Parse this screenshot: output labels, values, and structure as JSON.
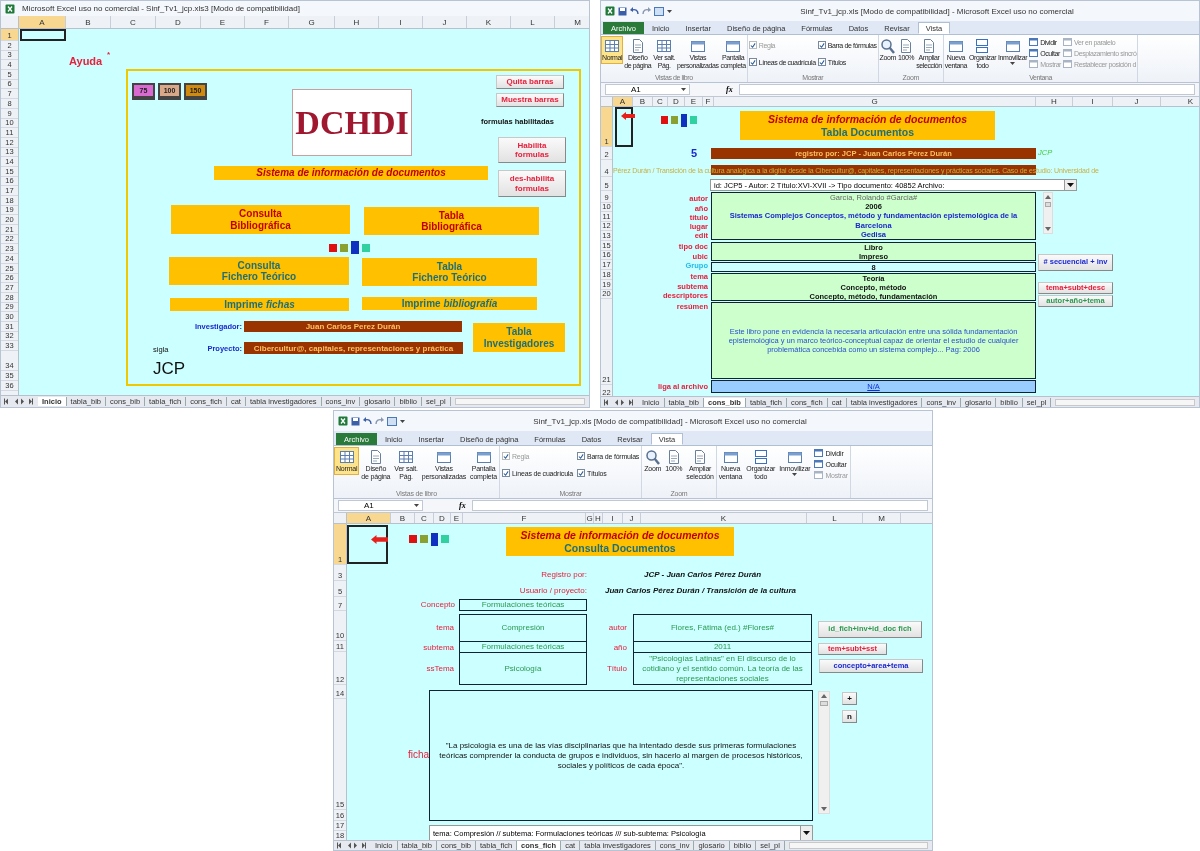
{
  "windows": [
    {
      "title": "Microsoft Excel uso no comercial - Sinf_Tv1_jcp.xls3 [Modo de compatibilidad]",
      "columns": [
        {
          "label": "A",
          "selected": true
        },
        {
          "label": "B",
          "selected": false
        },
        {
          "label": "C",
          "selected": false
        },
        {
          "label": "D",
          "selected": false
        },
        {
          "label": "E",
          "selected": false
        },
        {
          "label": "F",
          "selected": false
        },
        {
          "label": "G",
          "selected": false
        },
        {
          "label": "H",
          "selected": false
        },
        {
          "label": "I",
          "selected": false
        },
        {
          "label": "J",
          "selected": false
        },
        {
          "label": "K",
          "selected": false
        },
        {
          "label": "L",
          "selected": false
        },
        {
          "label": "M",
          "selected": false
        }
      ],
      "rows": [
        {
          "label": "1",
          "selected": true
        },
        {
          "label": "2",
          "selected": false
        },
        {
          "label": "3",
          "selected": false
        },
        {
          "label": "4",
          "selected": false
        },
        {
          "label": "5",
          "selected": false
        },
        {
          "label": "6",
          "selected": false
        },
        {
          "label": "7",
          "selected": false
        },
        {
          "label": "8",
          "selected": false
        },
        {
          "label": "9",
          "selected": false
        },
        {
          "label": "10",
          "selected": false
        },
        {
          "label": "11",
          "selected": false
        },
        {
          "label": "12",
          "selected": false
        },
        {
          "label": "13",
          "selected": false
        },
        {
          "label": "14",
          "selected": false
        },
        {
          "label": "15",
          "selected": false
        },
        {
          "label": "16",
          "selected": false
        },
        {
          "label": "17",
          "selected": false
        },
        {
          "label": "18",
          "selected": false
        },
        {
          "label": "19",
          "selected": false
        },
        {
          "label": "20",
          "selected": false
        },
        {
          "label": "21",
          "selected": false
        },
        {
          "label": "22",
          "selected": false
        },
        {
          "label": "23",
          "selected": false
        },
        {
          "label": "24",
          "selected": false
        },
        {
          "label": "25",
          "selected": false
        },
        {
          "label": "26",
          "selected": false
        },
        {
          "label": "27",
          "selected": false
        },
        {
          "label": "28",
          "selected": false
        },
        {
          "label": "29",
          "selected": false
        },
        {
          "label": "30",
          "selected": false
        },
        {
          "label": "31",
          "selected": false
        },
        {
          "label": "32",
          "selected": false
        },
        {
          "label": "33",
          "selected": false
        },
        {
          "label": "34",
          "selected": false
        },
        {
          "label": "35",
          "selected": false
        },
        {
          "label": "36",
          "selected": false
        }
      ],
      "shapes": [
        {
          "kind": "selected_cell"
        },
        {
          "kind": "label",
          "text": "Ayuda",
          "bold": true
        },
        {
          "kind": "label",
          "text": "*",
          "bold": true
        },
        {
          "kind": "frame"
        },
        {
          "kind": "monitors",
          "items": [
            {
              "text": "75",
              "color": "#d86ad0"
            },
            {
              "text": "100",
              "color": "#d8a888"
            },
            {
              "text": "150",
              "color": "#d08a10"
            }
          ]
        },
        {
          "kind": "logo",
          "text": "DCHDI"
        },
        {
          "kind": "button",
          "text": "Quita barras"
        },
        {
          "kind": "button",
          "text": "Muestra barras"
        },
        {
          "kind": "label",
          "text": "formulas habilitadas",
          "bold": true
        },
        {
          "kind": "button",
          "text": "Habilita formulas"
        },
        {
          "kind": "button",
          "text": "des-habilita formulas"
        },
        {
          "kind": "banner",
          "text": "Sistema de información de documentos",
          "italic": true
        },
        {
          "kind": "bar",
          "text": "Consulta\nBibliográfica"
        },
        {
          "kind": "bar",
          "text": "Tabla\nBibliográfica"
        },
        {
          "kind": "squares",
          "items": [
            {
              "color": "#e01010"
            },
            {
              "color": "#8aa030"
            },
            {
              "color": "#1030c0"
            },
            {
              "color": "#30d0a0"
            }
          ]
        },
        {
          "kind": "bar",
          "text": "Consulta\nFichero Teórico"
        },
        {
          "kind": "bar",
          "text": "Tabla\nFichero Teórico"
        },
        {
          "kind": "bar",
          "text": "Imprime *fichas*"
        },
        {
          "kind": "bar",
          "text": "Imprime *bibliografía*"
        },
        {
          "kind": "label",
          "text": "Investigador:",
          "bold": true
        },
        {
          "kind": "field",
          "text": "Juan Carlos Perez Durán"
        },
        {
          "kind": "label",
          "text": "Proyecto:",
          "bold": true
        },
        {
          "kind": "field",
          "text": "Cibercultur@, capitales, representaciones y práctica"
        },
        {
          "kind": "bar",
          "text": "Tabla\nInvestigadores"
        },
        {
          "kind": "label",
          "text": "sigla",
          "bold": false
        },
        {
          "kind": "label",
          "text": "JCP",
          "bold": false
        }
      ],
      "sheet_tabs": [
        {
          "label": "Inicio",
          "selected": true
        },
        {
          "label": "tabla_bib",
          "selected": false
        },
        {
          "label": "cons_bib",
          "selected": false
        },
        {
          "label": "tabla_fich",
          "selected": false
        },
        {
          "label": "cons_fich",
          "selected": false
        },
        {
          "label": "cat",
          "selected": false
        },
        {
          "label": "tabla investigadores",
          "selected": false
        },
        {
          "label": "cons_inv",
          "selected": false
        },
        {
          "label": "glosario",
          "selected": false
        },
        {
          "label": "biblio",
          "selected": false
        },
        {
          "label": "sel_pl",
          "selected": false
        }
      ]
    },
    {
      "title": "Sinf_Tv1_jcp.xls [Modo de compatibilidad] - Microsoft Excel uso no comercial",
      "ribbon": {
        "tabs": [
          {
            "label": "Archivo",
            "kind": "file",
            "selected": false
          },
          {
            "label": "Inicio",
            "kind": "tab",
            "selected": false
          },
          {
            "label": "Insertar",
            "kind": "tab",
            "selected": false
          },
          {
            "label": "Diseño de página",
            "kind": "tab",
            "selected": false
          },
          {
            "label": "Fórmulas",
            "kind": "tab",
            "selected": false
          },
          {
            "label": "Datos",
            "kind": "tab",
            "selected": false
          },
          {
            "label": "Revisar",
            "kind": "tab",
            "selected": false
          },
          {
            "label": "Vista",
            "kind": "tab",
            "selected": true
          }
        ],
        "groups": [
          {
            "label": "Vistas de libro",
            "items": [
              {
                "kind": "large",
                "label": "Normal",
                "selected": true
              },
              {
                "kind": "large",
                "label": "Diseño\nde página",
                "selected": false
              },
              {
                "kind": "large",
                "label": "Ver salt.\nPág.",
                "selected": false
              },
              {
                "kind": "large",
                "label": "Vistas\npersonalizadas",
                "selected": false
              },
              {
                "kind": "large",
                "label": "Pantalla\ncompleta",
                "selected": false
              }
            ]
          },
          {
            "label": "Mostrar",
            "items": [
              {
                "kind": "check",
                "label": "Regla",
                "checked": true,
                "disabled": true
              },
              {
                "kind": "check",
                "label": "Líneas de cuadrícula",
                "checked": true,
                "disabled": false
              },
              {
                "kind": "check",
                "label": "Barra de fórmulas",
                "checked": true,
                "disabled": false
              },
              {
                "kind": "check",
                "label": "Títulos",
                "checked": true,
                "disabled": false
              }
            ]
          },
          {
            "label": "Zoom",
            "items": [
              {
                "kind": "large",
                "label": "Zoom",
                "selected": false
              },
              {
                "kind": "large",
                "label": "100%",
                "selected": false
              },
              {
                "kind": "large",
                "label": "Ampliar\nselección",
                "selected": false
              }
            ]
          },
          {
            "label": "Ventana",
            "items": [
              {
                "kind": "large",
                "label": "Nueva\nventana",
                "selected": false
              },
              {
                "kind": "large",
                "label": "Organizar\ntodo",
                "selected": false
              },
              {
                "kind": "large",
                "label": "Inmovilizar",
                "selected": false,
                "menu": true
              },
              {
                "kind": "small",
                "label": "Dividir",
                "disabled": false
              },
              {
                "kind": "small",
                "label": "Ocultar",
                "disabled": false
              },
              {
                "kind": "small",
                "label": "Mostrar",
                "disabled": true
              },
              {
                "kind": "small",
                "label": "Ver en paralelo",
                "disabled": true
              },
              {
                "kind": "small",
                "label": "Desplazamiento sincró",
                "disabled": true
              },
              {
                "kind": "small",
                "label": "Restablecer posición d",
                "disabled": true
              }
            ]
          }
        ]
      },
      "formula_bar": {
        "name_box": "A1",
        "function_label": "fx"
      },
      "columns": [
        {
          "label": "A",
          "selected": true
        },
        {
          "label": "B",
          "selected": false
        },
        {
          "label": "C",
          "selected": false
        },
        {
          "label": "D",
          "selected": false
        },
        {
          "label": "E",
          "selected": false
        },
        {
          "label": "F",
          "selected": false
        },
        {
          "label": "G",
          "selected": false
        },
        {
          "label": "H",
          "selected": false
        },
        {
          "label": "I",
          "selected": false
        },
        {
          "label": "J",
          "selected": false
        },
        {
          "label": "K",
          "selected": false
        }
      ],
      "rows": [
        {
          "label": "1",
          "selected": true
        },
        {
          "label": "2",
          "selected": false
        },
        {
          "label": "4",
          "selected": false
        },
        {
          "label": "5",
          "selected": false
        },
        {
          "label": "9",
          "selected": false
        },
        {
          "label": "10",
          "selected": false
        },
        {
          "label": "11",
          "selected": false
        },
        {
          "label": "12",
          "selected": false
        },
        {
          "label": "13",
          "selected": false
        },
        {
          "label": "15",
          "selected": false
        },
        {
          "label": "16",
          "selected": false
        },
        {
          "label": "17",
          "selected": false
        },
        {
          "label": "18",
          "selected": false
        },
        {
          "label": "19",
          "selected": false
        },
        {
          "label": "20",
          "selected": false
        },
        {
          "label": "21",
          "selected": false
        },
        {
          "label": "22",
          "selected": false
        }
      ],
      "shapes": [
        {
          "kind": "selected_cell"
        },
        {
          "kind": "arrow"
        },
        {
          "kind": "squares",
          "items": [
            {
              "color": "#e01010"
            },
            {
              "color": "#8aa030"
            },
            {
              "color": "#1030c0"
            },
            {
              "color": "#30d0a0"
            }
          ]
        },
        {
          "kind": "title_box",
          "lines": [
            {
              "text": "Sistema de información de documentos",
              "italic": true
            },
            {
              "text": "Tabla Documentos",
              "italic": false
            }
          ]
        },
        {
          "kind": "label",
          "text": "5",
          "bold": true
        },
        {
          "kind": "field",
          "text": "registro por: JCP - Juan Carlos Pérez Durán"
        },
        {
          "kind": "label",
          "text": "JCP",
          "bold": false,
          "italic": true
        },
        {
          "kind": "banded_label",
          "text": "Pérez Durán / Transición de la cultura analógica a la digital desde la Cibercultur@, capitales, representaciones y prácticas sociales. Caso de estudio: Universidad de"
        },
        {
          "kind": "combo",
          "text": "id: JCP5 - Autor: 2 Título:XVI-XVII -> Tipo documento: 40852 Archivo:"
        },
        {
          "kind": "labels",
          "bold": true,
          "items": [
            {
              "text": "autor"
            },
            {
              "text": "año"
            },
            {
              "text": "título"
            },
            {
              "text": "lugar"
            },
            {
              "text": "edit"
            },
            {
              "text": "tipo doc"
            },
            {
              "text": "ubic"
            },
            {
              "text": "Grupo"
            },
            {
              "text": "tema"
            },
            {
              "text": "subtema"
            },
            {
              "text": "descriptores"
            },
            {
              "text": "resúmen"
            }
          ]
        },
        {
          "kind": "box",
          "color": "#ccffcc",
          "sections": [
            {
              "lines": [
                {
                  "text": "García, Rolando #Garcia#",
                  "bold": false
                },
                {
                  "text": "2006",
                  "bold": true
                },
                {
                  "text": "Sistemas Complejos Conceptos, método y fundamentación epistemológica de la",
                  "bold": true
                },
                {
                  "text": "Barcelona",
                  "bold": true
                },
                {
                  "text": "Gedisa",
                  "bold": true
                }
              ]
            }
          ]
        },
        {
          "kind": "scrollbar"
        },
        {
          "kind": "box",
          "color": "#ccffcc",
          "sections": [
            {
              "lines": [
                {
                  "text": "Libro",
                  "bold": true
                },
                {
                  "text": "Impreso",
                  "bold": true
                }
              ]
            }
          ]
        },
        {
          "kind": "box",
          "color": "#ccffff",
          "sections": [
            {
              "lines": [
                {
                  "text": "8",
                  "bold": true
                }
              ]
            }
          ]
        },
        {
          "kind": "box",
          "color": "#ccffcc",
          "sections": [
            {
              "lines": [
                {
                  "text": "Teoría",
                  "bold": true
                },
                {
                  "text": "Concepto, método",
                  "bold": true
                },
                {
                  "text": "Concepto, método, fundamentación",
                  "bold": true
                }
              ]
            }
          ]
        },
        {
          "kind": "box",
          "color": "#ccffcc",
          "sections": [
            {
              "lines": [
                {
                  "text": "Este libro pone en evidencia la necesaria articulación entre una sólida fundamentación epistemológica y un marco teórico-conceptual capaz de orientar el estudio de cualquier problemática concebida como un sistema complejo... Pag: 2006",
                  "bold": false
                }
              ]
            }
          ]
        },
        {
          "kind": "box",
          "color": "#99ccff",
          "sections": [
            {
              "lines": [
                {
                  "text": "N/A",
                  "kind": "link",
                  "bold": false
                }
              ]
            }
          ]
        },
        {
          "kind": "button",
          "text": "# secuencial + inv"
        },
        {
          "kind": "button",
          "text": "tema+subt+desc"
        },
        {
          "kind": "button",
          "text": "autor+año+tema"
        },
        {
          "kind": "label",
          "text": "liga al archivo",
          "bold": true
        }
      ],
      "sheet_tabs": [
        {
          "label": "Inicio",
          "selected": false
        },
        {
          "label": "tabla_bib",
          "selected": false
        },
        {
          "label": "cons_bib",
          "selected": true
        },
        {
          "label": "tabla_fich",
          "selected": false
        },
        {
          "label": "cons_fich",
          "selected": false
        },
        {
          "label": "cat",
          "selected": false
        },
        {
          "label": "tabla investigadores",
          "selected": false
        },
        {
          "label": "cons_inv",
          "selected": false
        },
        {
          "label": "glosario",
          "selected": false
        },
        {
          "label": "biblio",
          "selected": false
        },
        {
          "label": "sel_pl",
          "selected": false
        }
      ]
    },
    {
      "title": "Sinf_Tv1_jcp.xls [Modo de compatibilidad] - Microsoft Excel uso no comercial",
      "ribbon": {
        "tabs": [
          {
            "label": "Archivo",
            "kind": "file",
            "selected": false
          },
          {
            "label": "Inicio",
            "kind": "tab",
            "selected": false
          },
          {
            "label": "Insertar",
            "kind": "tab",
            "selected": false
          },
          {
            "label": "Diseño de página",
            "kind": "tab",
            "selected": false
          },
          {
            "label": "Fórmulas",
            "kind": "tab",
            "selected": false
          },
          {
            "label": "Datos",
            "kind": "tab",
            "selected": false
          },
          {
            "label": "Revisar",
            "kind": "tab",
            "selected": false
          },
          {
            "label": "Vista",
            "kind": "tab",
            "selected": true
          }
        ],
        "groups": [
          {
            "label": "Vistas de libro",
            "items": [
              {
                "kind": "large",
                "label": "Normal",
                "selected": true
              },
              {
                "kind": "large",
                "label": "Diseño\nde página",
                "selected": false
              },
              {
                "kind": "large",
                "label": "Ver salt.\nPág.",
                "selected": false
              },
              {
                "kind": "large",
                "label": "Vistas\npersonalizadas",
                "selected": false
              },
              {
                "kind": "large",
                "label": "Pantalla\ncompleta",
                "selected": false
              }
            ]
          },
          {
            "label": "Mostrar",
            "items": [
              {
                "kind": "check",
                "label": "Regla",
                "checked": true,
                "disabled": true
              },
              {
                "kind": "check",
                "label": "Líneas de cuadrícula",
                "checked": true,
                "disabled": false
              },
              {
                "kind": "check",
                "label": "Barra de fórmulas",
                "checked": true,
                "disabled": false
              },
              {
                "kind": "check",
                "label": "Títulos",
                "checked": true,
                "disabled": false
              }
            ]
          },
          {
            "label": "Zoom",
            "items": [
              {
                "kind": "large",
                "label": "Zoom",
                "selected": false
              },
              {
                "kind": "large",
                "label": "100%",
                "selected": false
              },
              {
                "kind": "large",
                "label": "Ampliar\nselección",
                "selected": false
              }
            ]
          },
          {
            "items": [
              {
                "kind": "large",
                "label": "Nueva\nventana",
                "selected": false
              },
              {
                "kind": "large",
                "label": "Organizar\ntodo",
                "selected": false
              },
              {
                "kind": "large",
                "label": "Inmovilizar",
                "selected": false,
                "menu": true
              },
              {
                "kind": "small",
                "label": "Dividir",
                "disabled": false
              },
              {
                "kind": "small",
                "label": "Ocultar",
                "disabled": false
              },
              {
                "kind": "small",
                "label": "Mostrar",
                "disabled": true
              }
            ]
          }
        ]
      },
      "formula_bar": {
        "name_box": "A1",
        "function_label": "fx"
      },
      "columns": [
        {
          "label": "A",
          "selected": true
        },
        {
          "label": "B",
          "selected": false
        },
        {
          "label": "C",
          "selected": false
        },
        {
          "label": "D",
          "selected": false
        },
        {
          "label": "E",
          "selected": false
        },
        {
          "label": "F",
          "selected": false
        },
        {
          "label": "G",
          "selected": false
        },
        {
          "label": "H",
          "selected": false
        },
        {
          "label": "I",
          "selected": false
        },
        {
          "label": "J",
          "selected": false
        },
        {
          "label": "K",
          "selected": false
        },
        {
          "label": "L",
          "selected": false
        },
        {
          "label": "M",
          "selected": false
        }
      ],
      "rows": [
        {
          "label": "1",
          "selected": true
        },
        {
          "label": "3",
          "selected": false
        },
        {
          "label": "5",
          "selected": false
        },
        {
          "label": "7",
          "selected": false
        },
        {
          "label": "10",
          "selected": false
        },
        {
          "label": "11",
          "selected": false
        },
        {
          "label": "12",
          "selected": false
        },
        {
          "label": "14",
          "selected": false
        },
        {
          "label": "15",
          "selected": false
        },
        {
          "label": "16",
          "selected": false
        },
        {
          "label": "17",
          "selected": false
        },
        {
          "label": "18",
          "selected": false
        }
      ],
      "shapes": [
        {
          "kind": "selected_cell"
        },
        {
          "kind": "arrow"
        },
        {
          "kind": "squares",
          "items": [
            {
              "color": "#e01010"
            },
            {
              "color": "#8aa030"
            },
            {
              "color": "#1030c0"
            },
            {
              "color": "#30d0a0"
            }
          ]
        },
        {
          "kind": "title_box",
          "lines": [
            {
              "text": "Sistema de información de documentos",
              "italic": true
            },
            {
              "text": "Consulta Documentos",
              "italic": false
            }
          ]
        },
        {
          "kind": "label",
          "text": "Registro por:",
          "bold": false
        },
        {
          "kind": "label",
          "text": "JCP - Juan Carlos Pérez Durán",
          "bold": true,
          "italic": true
        },
        {
          "kind": "label",
          "text": "Usuario / proyecto:",
          "bold": false
        },
        {
          "kind": "label",
          "text": "Juan Carlos Pérez Durán / Transición de la cultura",
          "bold": true,
          "italic": true
        },
        {
          "kind": "label",
          "text": "Concepto",
          "bold": false
        },
        {
          "kind": "box",
          "color": "#ccffff",
          "sections": [
            {
              "lines": [
                {
                  "text": "Formulaciones teóricas",
                  "bold": false
                }
              ]
            }
          ]
        },
        {
          "kind": "labels",
          "bold": false,
          "items": [
            {
              "text": "tema"
            },
            {
              "text": "subtema"
            },
            {
              "text": "ssTema"
            }
          ]
        },
        {
          "kind": "box",
          "color": "#ccffff",
          "sections": [
            {
              "lines": [
                {
                  "text": "Compresión",
                  "bold": false
                }
              ]
            },
            {
              "lines": [
                {
                  "text": "Formulaciones teóricas",
                  "bold": false
                }
              ]
            },
            {
              "lines": [
                {
                  "text": "Psicología",
                  "bold": false
                }
              ]
            }
          ]
        },
        {
          "kind": "labels",
          "bold": false,
          "items": [
            {
              "text": "autor"
            },
            {
              "text": "año"
            },
            {
              "text": "Título"
            }
          ]
        },
        {
          "kind": "box",
          "color": "#ccffff",
          "sections": [
            {
              "lines": [
                {
                  "text": "Flores, Fátima (ed.) #Flores#",
                  "bold": false
                }
              ]
            },
            {
              "lines": [
                {
                  "text": "2011",
                  "bold": false
                }
              ]
            },
            {
              "lines": [
                {
                  "text": "\"Psicologías Latinas\" en El discurso de lo cotidiano y el sentido común. La teoría de las representaciones sociales",
                  "bold": false
                }
              ]
            }
          ]
        },
        {
          "kind": "button",
          "text": "id_fich+inv+id_doc fich"
        },
        {
          "kind": "button",
          "text": "tem+subt+sst"
        },
        {
          "kind": "button",
          "text": "concepto+area+tema"
        },
        {
          "kind": "label",
          "text": "ficha",
          "bold": false
        },
        {
          "kind": "box",
          "color": "#ccffff",
          "sections": [
            {
              "lines": [
                {
                  "text": "\"La psicología es una de las vías disciplinarias que ha intentado desde sus primeras formulaciones teóricas comprender la conducta de grupos e individuos, sin hacerlo al margen de procesos históricos, sociales y políticos de cada época\".",
                  "bold": false
                }
              ]
            }
          ]
        },
        {
          "kind": "scrollbar"
        },
        {
          "kind": "button",
          "text": "+"
        },
        {
          "kind": "button",
          "text": "n"
        },
        {
          "kind": "combo",
          "text": "tema: Compresión // subtema: Formulaciones teóricas /// sub-subtema: Psicología"
        }
      ],
      "sheet_tabs": [
        {
          "label": "Inicio",
          "selected": false
        },
        {
          "label": "tabla_bib",
          "selected": false
        },
        {
          "label": "cons_bib",
          "selected": false
        },
        {
          "label": "tabla_fich",
          "selected": false
        },
        {
          "label": "cons_fich",
          "selected": true
        },
        {
          "label": "cat",
          "selected": false
        },
        {
          "label": "tabla investigadores",
          "selected": false
        },
        {
          "label": "cons_inv",
          "selected": false
        },
        {
          "label": "glosario",
          "selected": false
        },
        {
          "label": "biblio",
          "selected": false
        },
        {
          "label": "sel_pl",
          "selected": false
        }
      ]
    }
  ]
}
